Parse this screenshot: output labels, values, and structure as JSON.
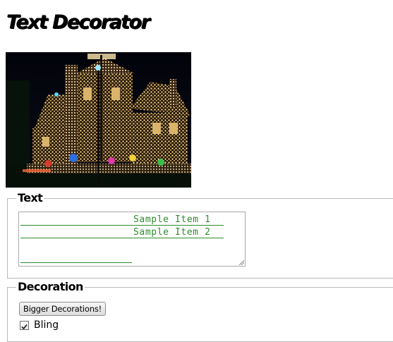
{
  "header": {
    "title": "Text Decorator"
  },
  "hero_image": {
    "subject": "house covered in holiday lights at night"
  },
  "text_section": {
    "legend": "Text",
    "lines": [
      "Sample Item 1",
      "Sample Item 2",
      ""
    ],
    "decoration_color": "#2e8b2e"
  },
  "decoration_section": {
    "legend": "Decoration",
    "button_label": "Bigger Decorations!",
    "bling": {
      "label": "Bling",
      "checked": true
    }
  }
}
